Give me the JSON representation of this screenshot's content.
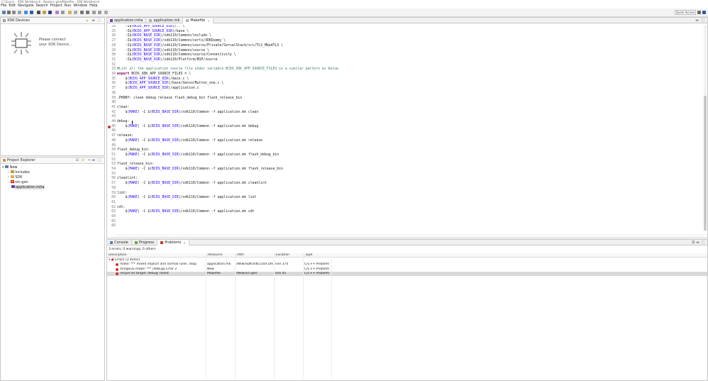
{
  "window": {
    "title": "C:\\Users\\... XDK Workbench - New/src-gen/Makefile - XDK Workbench"
  },
  "menu": [
    "File",
    "Edit",
    "Navigate",
    "Search",
    "Project",
    "Run",
    "Window",
    "Help"
  ],
  "toolbar": {
    "quick_access": "Quick Access"
  },
  "xdk_devices": {
    "title": "XDK Devices",
    "message_line1": "Please connect",
    "message_line2": "your XDK Device..."
  },
  "project_explorer": {
    "title": "Project Explorer",
    "root": "New",
    "children": [
      "Includes",
      "SDK",
      "src-gen",
      "application.mita"
    ]
  },
  "editor": {
    "tabs": [
      {
        "label": "application.mita",
        "active": false
      },
      {
        "label": "application.mk",
        "active": false
      },
      {
        "label": "Makefile",
        "active": true
      }
    ],
    "lines": [
      {
        "n": "24",
        "t": "    -I$(BCDS_APP_SOURCE_DIR)/.. \\"
      },
      {
        "n": "25",
        "t": "    -I$(BCDS_APP_SOURCE_DIR)/base \\"
      },
      {
        "n": "26",
        "t": "    -I$(BCDS_BASE_DIR)/xdk110/Common/include \\"
      },
      {
        "n": "27",
        "t": "    -I$(BCDS_BASE_DIR)/xdk110/Common/certs/XDKDummy \\"
      },
      {
        "n": "28",
        "t": "    -I$(BCDS_BASE_DIR)/xdk110/Common/source/Private/ServalStack/src/TLS_MbedTLS \\"
      },
      {
        "n": "29",
        "t": "    -I$(BCDS_BASE_DIR)/xdk110/Common/source \\"
      },
      {
        "n": "30",
        "t": "    -I$(BCDS_BASE_DIR)/xdk110/Common/source/Connectivity \\"
      },
      {
        "n": "31",
        "t": "    -I$(BCDS_BASE_DIR)/xdk110/Platform/BSP/source"
      },
      {
        "n": "32",
        "t": ""
      },
      {
        "n": "33",
        "t": "#List all the application source file under variable BCDS_XDK_APP_SOURCE_FILES in a similar pattern as below"
      },
      {
        "n": "34",
        "t": "export BCDS_XDK_APP_SOURCE_FILES = \\"
      },
      {
        "n": "35",
        "t": "    $(BCDS_APP_SOURCE_DIR)/main.c \\"
      },
      {
        "n": "36",
        "t": "    $(BCDS_APP_SOURCE_DIR)/base/SensorButton_one.c \\"
      },
      {
        "n": "37",
        "t": "    $(BCDS_APP_SOURCE_DIR)/application.c"
      },
      {
        "n": "38",
        "t": ""
      },
      {
        "n": "39",
        "t": ".PHONY: clean debug release flash_debug_bin flash_release_bin"
      },
      {
        "n": "40",
        "t": ""
      },
      {
        "n": "41",
        "t": "clean:"
      },
      {
        "n": "42",
        "t": "    $(MAKE) -C $(BCDS_BASE_DIR)/xdk110/Common -f application.mk clean"
      },
      {
        "n": "43",
        "t": ""
      },
      {
        "n": "44",
        "t": "debug: "
      },
      {
        "n": "45",
        "t": "    $(MAKE) -C $(BCDS_BASE_DIR)/xdk110/Common -f application.mk debug"
      },
      {
        "n": "46",
        "t": ""
      },
      {
        "n": "47",
        "t": "release:"
      },
      {
        "n": "48",
        "t": "    $(MAKE) -C $(BCDS_BASE_DIR)/xdk110/Common -f application.mk release"
      },
      {
        "n": "49",
        "t": ""
      },
      {
        "n": "50",
        "t": "flash_debug_bin:"
      },
      {
        "n": "51",
        "t": "    $(MAKE) -C $(BCDS_BASE_DIR)/xdk110/Common -f application.mk flash_debug_bin"
      },
      {
        "n": "52",
        "t": ""
      },
      {
        "n": "53",
        "t": "flash_release_bin:"
      },
      {
        "n": "54",
        "t": "    $(MAKE) -C $(BCDS_BASE_DIR)/xdk110/Common -f application.mk flash_release_bin"
      },
      {
        "n": "55",
        "t": ""
      },
      {
        "n": "56",
        "t": "cleanlint:"
      },
      {
        "n": "57",
        "t": "    $(MAKE) -C $(BCDS_BASE_DIR)/xdk110/Common -f application.mk cleanlint"
      },
      {
        "n": "58",
        "t": ""
      },
      {
        "n": "59",
        "t": "lint:"
      },
      {
        "n": "60",
        "t": "    $(MAKE) -C $(BCDS_BASE_DIR)/xdk110/Common -f application.mk lint"
      },
      {
        "n": "61",
        "t": ""
      },
      {
        "n": "62",
        "t": "cdt:"
      },
      {
        "n": "63",
        "t": "    $(MAKE) -C $(BCDS_BASE_DIR)/xdk110/Common -f application.mk cdt"
      },
      {
        "n": "64",
        "t": ""
      },
      {
        "n": "65",
        "t": ""
      },
      {
        "n": "66",
        "t": ""
      }
    ],
    "error_line": "45"
  },
  "bottom": {
    "tabs": [
      "Console",
      "Progress",
      "Problems"
    ],
    "summary": "3 errors, 0 warnings, 0 others",
    "columns": [
      "Description",
      "Resource",
      "Path",
      "Location",
      "Type"
    ],
    "group": "Errors (3 items)",
    "rows": [
      {
        "desc": "make: *** mixed implicit and normal rules.  Stop.",
        "resource": "application.mk",
        "path": "/New/SDK/xdk110/Com...",
        "location": "line 374",
        "type": "C/C++ Problem"
      },
      {
        "desc": "mingw32-make: *** [debug] Error 2",
        "resource": "New",
        "path": "",
        "location": "",
        "type": "C/C++ Problem"
      },
      {
        "desc": "recipe for target 'debug' failed",
        "resource": "Makefile",
        "path": "/New/src-gen",
        "location": "line 45",
        "type": "C/C++ Problem"
      }
    ]
  },
  "colors": {
    "keyword": "#7f0055",
    "variable": "#2a00ff",
    "comment": "#3f7f5f",
    "error": "#d32f2f",
    "selection": "#d9d9d9"
  }
}
